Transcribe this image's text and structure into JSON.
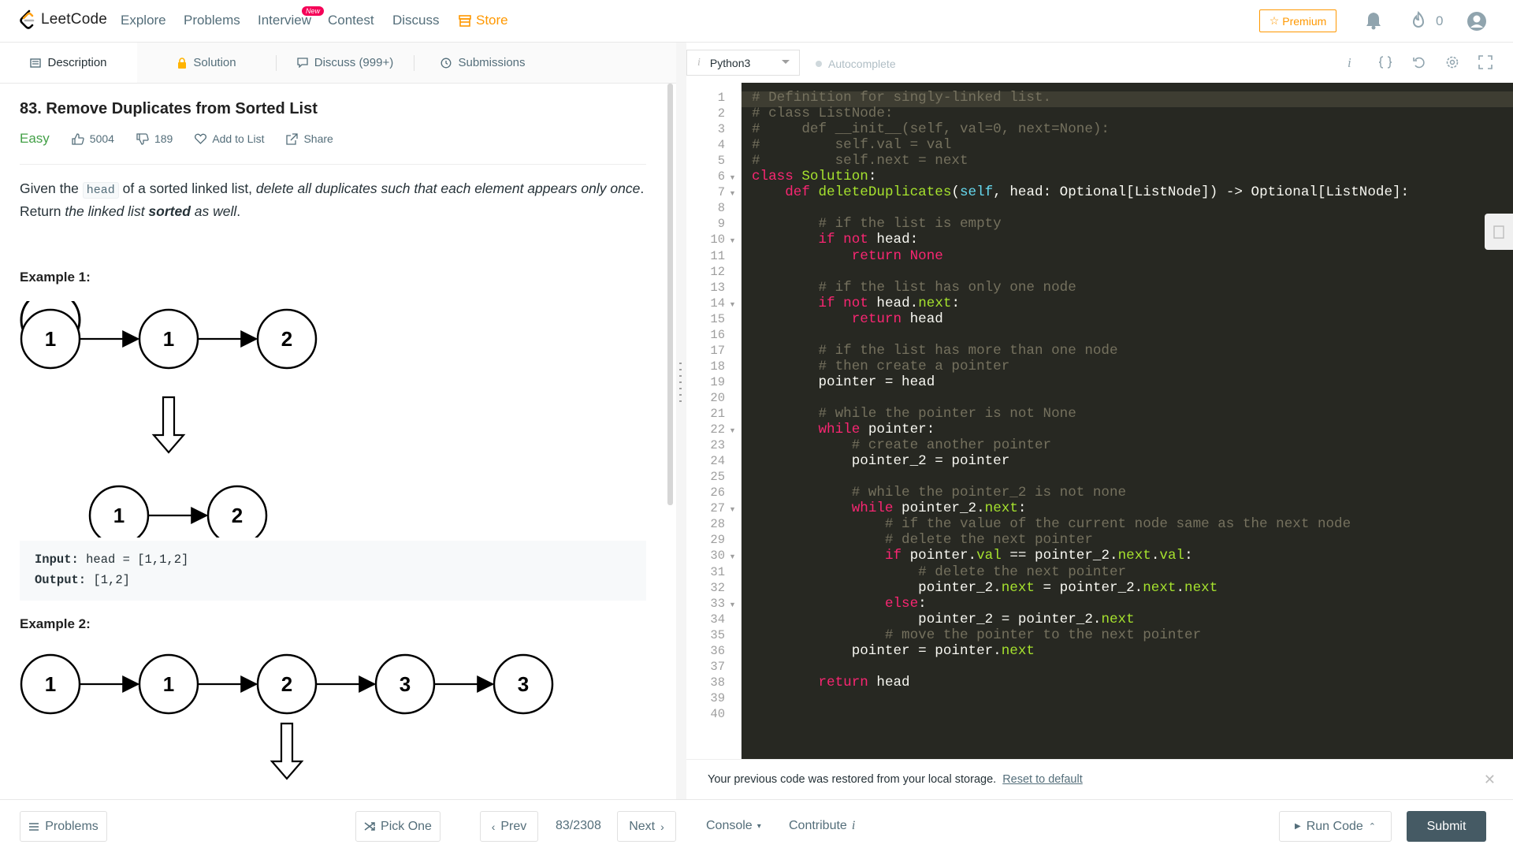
{
  "nav": {
    "logo_text": "LeetCode",
    "links": [
      "Explore",
      "Problems",
      "Interview",
      "Contest",
      "Discuss",
      "Store"
    ],
    "new_badge": "New",
    "premium_label": "Premium",
    "streak_count": "0",
    "colors": {
      "store": "#ff9800",
      "premium": "#ff9800",
      "badge": "#f50057"
    }
  },
  "tabs": {
    "description": "Description",
    "solution": "Solution",
    "discuss": "Discuss (999+)",
    "submissions": "Submissions"
  },
  "problem": {
    "title": "83. Remove Duplicates from Sorted List",
    "difficulty": "Easy",
    "likes": "5004",
    "dislikes": "189",
    "add_to_list": "Add to List",
    "share": "Share",
    "desc_1": "Given the ",
    "desc_code": "head",
    "desc_2": " of a sorted linked list, ",
    "desc_em1": "delete all duplicates such that each element appears only once",
    "desc_3": ". Return ",
    "desc_em2": "the linked list ",
    "desc_strong": "sorted",
    "desc_em3": " as well",
    "desc_4": ".",
    "example1_title": "Example 1:",
    "example1_input_label": "Input:",
    "example1_input": " head = [1,1,2]",
    "example1_output_label": "Output:",
    "example1_output": " [1,2]",
    "example2_title": "Example 2:",
    "diagram1_top": [
      "1",
      "1",
      "2"
    ],
    "diagram1_bottom": [
      "1",
      "2"
    ],
    "diagram2_top": [
      "1",
      "1",
      "2",
      "3",
      "3"
    ]
  },
  "editor": {
    "language": "Python3",
    "autocomplete": "Autocomplete",
    "line_numbers": [
      "1",
      "2",
      "3",
      "4",
      "5",
      "6",
      "7",
      "8",
      "9",
      "10",
      "11",
      "12",
      "13",
      "14",
      "15",
      "16",
      "17",
      "18",
      "19",
      "20",
      "21",
      "22",
      "23",
      "24",
      "25",
      "26",
      "27",
      "28",
      "29",
      "30",
      "31",
      "32",
      "33",
      "34",
      "35",
      "36",
      "37",
      "38",
      "39",
      "40"
    ],
    "lines": [
      "# Definition for singly-linked list.",
      "# class ListNode:",
      "#     def __init__(self, val=0, next=None):",
      "#         self.val = val",
      "#         self.next = next",
      "class Solution:",
      "    def deleteDuplicates(self, head: Optional[ListNode]) -> Optional[ListNode]:",
      "",
      "        # if the list is empty",
      "        if not head:",
      "            return None",
      "",
      "        # if the list has only one node",
      "        if not head.next:",
      "            return head",
      "",
      "        # if the list has more than one node",
      "        # then create a pointer",
      "        pointer = head",
      "",
      "        # while the pointer is not None",
      "        while pointer:",
      "            # create another pointer",
      "            pointer_2 = pointer",
      "",
      "            # while the pointer_2 is not none",
      "            while pointer_2.next:",
      "                # if the value of the current node same as the next node",
      "                # delete the next pointer",
      "                if pointer.val == pointer_2.next.val:",
      "                    # delete the next pointer",
      "                    pointer_2.next = pointer_2.next.next",
      "                else:",
      "                    pointer_2 = pointer_2.next",
      "                # move the pointer to the next pointer",
      "            pointer = pointer.next",
      "",
      "        return head",
      "",
      ""
    ],
    "restore_message": "Your previous code was restored from your local storage.",
    "reset_link": "Reset to default",
    "colors": {
      "background": "#272822",
      "keyword": "#f92672",
      "comment": "#75715e",
      "function": "#a6e22e",
      "builtin": "#66d9ef",
      "constant": "#ae81ff"
    }
  },
  "bottom": {
    "problems": "Problems",
    "pick_one": "Pick One",
    "prev": "Prev",
    "page": "83/2308",
    "next": "Next",
    "console": "Console",
    "contribute": "Contribute",
    "run_code": "Run Code",
    "submit": "Submit"
  }
}
